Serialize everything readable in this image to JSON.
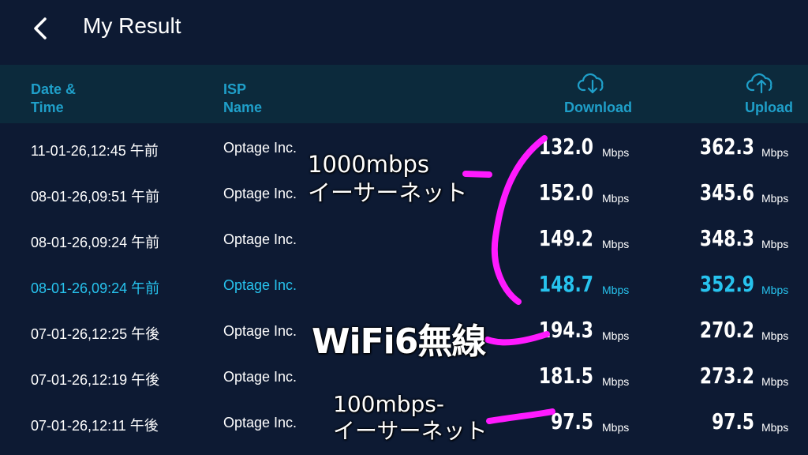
{
  "app": {
    "title": "My Result",
    "back_icon": "chevron-left-icon"
  },
  "header": {
    "date_line1": "Date &",
    "date_line2": "Time",
    "isp_line1": "ISP",
    "isp_line2": "Name",
    "download": "Download",
    "upload": "Upload",
    "download_icon": "cloud-download-icon",
    "upload_icon": "cloud-upload-icon"
  },
  "colors": {
    "background": "#0d1a33",
    "header_bg": "#0c2a3c",
    "accent": "#1f9fc9",
    "highlight": "#27c3ee",
    "annotation_stroke": "#ff1aff"
  },
  "rows": [
    {
      "datetime": "11-01-26,12:45 午前",
      "isp": "Optage Inc.",
      "download": "132.0",
      "download_unit": "Mbps",
      "upload": "362.3",
      "upload_unit": "Mbps"
    },
    {
      "datetime": "08-01-26,09:51 午前",
      "isp": "Optage Inc.",
      "download": "152.0",
      "download_unit": "Mbps",
      "upload": "345.6",
      "upload_unit": "Mbps"
    },
    {
      "datetime": "08-01-26,09:24 午前",
      "isp": "Optage Inc.",
      "download": "149.2",
      "download_unit": "Mbps",
      "upload": "348.3",
      "upload_unit": "Mbps"
    },
    {
      "datetime": "08-01-26,09:24 午前",
      "isp": "Optage Inc.",
      "download": "148.7",
      "download_unit": "Mbps",
      "upload": "352.9",
      "upload_unit": "Mbps",
      "highlighted": true
    },
    {
      "datetime": "07-01-26,12:25 午後",
      "isp": "Optage Inc.",
      "download": "194.3",
      "download_unit": "Mbps",
      "upload": "270.2",
      "upload_unit": "Mbps"
    },
    {
      "datetime": "07-01-26,12:19 午後",
      "isp": "Optage Inc.",
      "download": "181.5",
      "download_unit": "Mbps",
      "upload": "273.2",
      "upload_unit": "Mbps"
    },
    {
      "datetime": "07-01-26,12:11 午後",
      "isp": "Optage Inc.",
      "download": "97.5",
      "download_unit": "Mbps",
      "upload": "97.5",
      "upload_unit": "Mbps"
    }
  ],
  "annotations": {
    "a1_line1": "1000mbps",
    "a1_line2": "イーサーネット",
    "a2": "WiFi6無線",
    "a3_line1": "100mbps-",
    "a3_line2": "イーサーネット"
  }
}
